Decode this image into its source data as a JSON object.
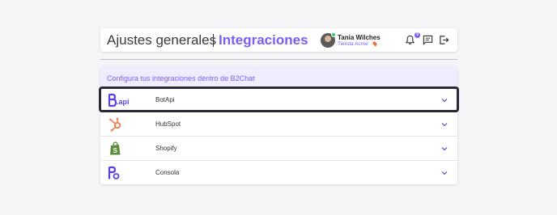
{
  "header": {
    "title": "Ajustes generales",
    "active_section": "Integraciones",
    "user": {
      "name": "Tania Wilches",
      "org": "Tienda Acme"
    },
    "notifications_count": "9"
  },
  "panel": {
    "title": "Configura tus integraciones dentro de B2Chat",
    "integrations": [
      {
        "label": "BotApi",
        "logo": "botapi-logo",
        "logo_text": ".api"
      },
      {
        "label": "HubSpot",
        "logo": "hubspot-logo"
      },
      {
        "label": "Shopify",
        "logo": "shopify-logo"
      },
      {
        "label": "Consola",
        "logo": "consola-logo"
      }
    ]
  },
  "colors": {
    "accent": "#7c5cf5",
    "hubspot": "#f57b48",
    "shopify": "#5e8e3e",
    "focus_ring": "#2a2a36"
  }
}
